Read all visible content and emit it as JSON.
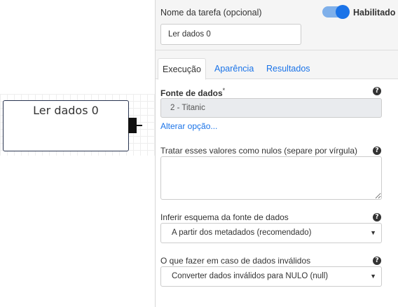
{
  "canvas": {
    "node_label": "Ler dados 0"
  },
  "header": {
    "task_name_label": "Nome da tarefa (opcional)",
    "task_name_value": "Ler dados 0",
    "enabled_label": "Habilitado",
    "enabled": true
  },
  "tabs": [
    {
      "label": "Execução",
      "active": true
    },
    {
      "label": "Aparência",
      "active": false
    },
    {
      "label": "Resultados",
      "active": false
    }
  ],
  "form": {
    "data_source": {
      "label": "Fonte de dados",
      "required_mark": "*",
      "value": "2 - Titanic",
      "change_link": "Alterar opção..."
    },
    "null_values": {
      "label": "Tratar esses valores como nulos (separe por vírgula)",
      "value": ""
    },
    "infer_schema": {
      "label": "Inferir esquema da fonte de dados",
      "selected": "A partir dos metadados (recomendado)"
    },
    "invalid_data": {
      "label": "O que fazer em caso de dados inválidos",
      "selected": "Converter dados inválidos para NULO (null)"
    }
  },
  "icons": {
    "help": "question-circle-icon",
    "dropdown": "caret-down-icon"
  },
  "colors": {
    "accent": "#1a73e8",
    "toggle_track": "#7fb0ea",
    "node_border": "#2a3550"
  }
}
